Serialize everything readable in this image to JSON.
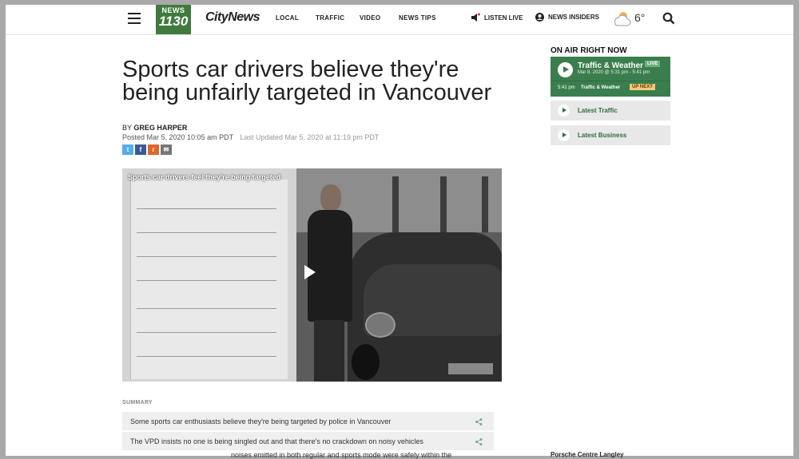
{
  "header": {
    "logo_top": "NEWS",
    "logo_num": "1130",
    "brand": "CityNews",
    "nav": [
      "LOCAL",
      "TRAFFIC",
      "VIDEO",
      "NEWS TIPS"
    ],
    "listen_live": "LISTEN LIVE",
    "news_insiders": "NEWS INSIDERS",
    "temperature": "6°"
  },
  "article": {
    "title": "Sports car drivers believe they're being unfairly targeted in Vancouver",
    "by_prefix": "BY",
    "author": "GREG HARPER",
    "posted": "Posted Mar 5, 2020 10:05 am PDT",
    "updated": "Last Updated Mar 5, 2020 at 11:19 pm PDT",
    "share_icons": [
      "twitter-icon",
      "facebook-icon",
      "reddit-icon",
      "email-icon"
    ],
    "share_glyphs": [
      "t",
      "f",
      "r",
      "✉"
    ],
    "video_title": "Sports car drivers feel they're being targeted",
    "summary_label": "SUMMARY",
    "summary": [
      "Some sports car enthusiasts believe they're being targeted by police in Vancouver",
      "The VPD insists no one is being singled out and that there's no crackdown on noisy vehicles"
    ],
    "body_fragment": "noises emitted in both regular and sports mode were safely within the"
  },
  "sidebar": {
    "on_air_heading": "ON AIR RIGHT NOW",
    "show": "Traffic & Weather",
    "live_badge": "LIVE",
    "show_time": "Mar 8, 2020 @ 5:31 pm - 5:41 pm",
    "next_time": "5:41 pm",
    "next_show": "Traffic & Weather",
    "up_next": "UP NEXT",
    "links": [
      "Latest Traffic",
      "Latest Business"
    ],
    "bottom_fragment": "Porsche Centre Langley"
  },
  "colors": {
    "brand_green": "#3f7b3f",
    "on_air_green": "#3b7e4d",
    "twitter": "#55acee",
    "facebook": "#3b5998",
    "reddit": "#e0662b",
    "email": "#777777"
  }
}
